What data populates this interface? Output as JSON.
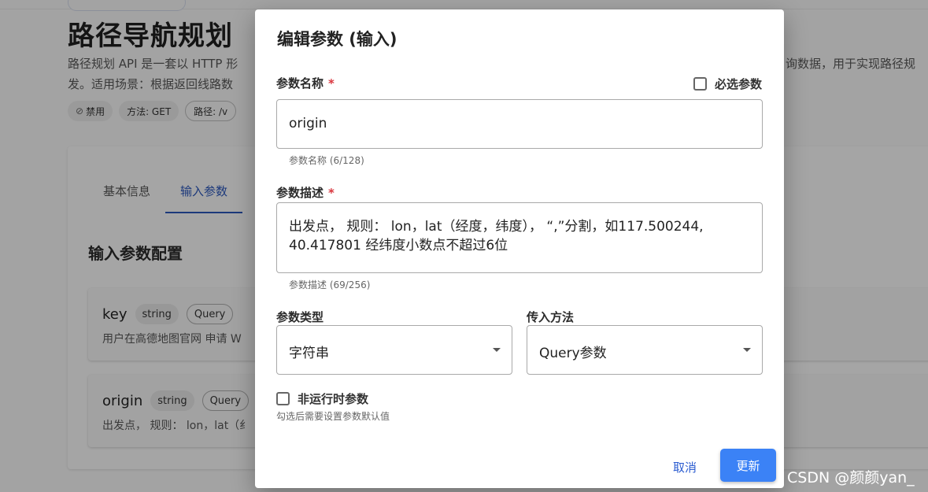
{
  "background": {
    "title": "路径导航规划",
    "description_line1": "路径规划 API 是一套以 HTTP 形",
    "description_line1_right": "询数据，用于实现路径规",
    "description_line2": "发。适用场景：根据返回线路数",
    "chips": [
      "禁用",
      "方法: GET",
      "路径: /v"
    ],
    "tabs": [
      "基本信息",
      "输入参数"
    ],
    "section_title": "输入参数配置",
    "params": [
      {
        "name": "key",
        "type": "string",
        "in": "Query",
        "desc": "用户在高德地图官网 申请 W"
      },
      {
        "name": "origin",
        "type": "string",
        "in": "Query",
        "desc": "出发点， 规则： lon，lat（纟"
      }
    ]
  },
  "dialog": {
    "title": "编辑参数 (输入)",
    "name_label": "参数名称",
    "required_mark": "*",
    "required_checkbox_label": "必选参数",
    "name_value": "origin",
    "name_hint": "参数名称 (6/128)",
    "desc_label": "参数描述",
    "desc_value": "出发点， 规则： lon，lat（经度，纬度）， “,”分割，如117.500244, 40.417801     经纬度小数点不超过6位",
    "desc_hint": "参数描述 (69/256)",
    "type_label": "参数类型",
    "type_value": "字符串",
    "method_label": "传入方法",
    "method_value": "Query参数",
    "runtime_checkbox_label": "非运行时参数",
    "runtime_hint": "勾选后需要设置参数默认值",
    "cancel_label": "取消",
    "update_label": "更新"
  },
  "watermark": "CSDN @颜颜yan_"
}
